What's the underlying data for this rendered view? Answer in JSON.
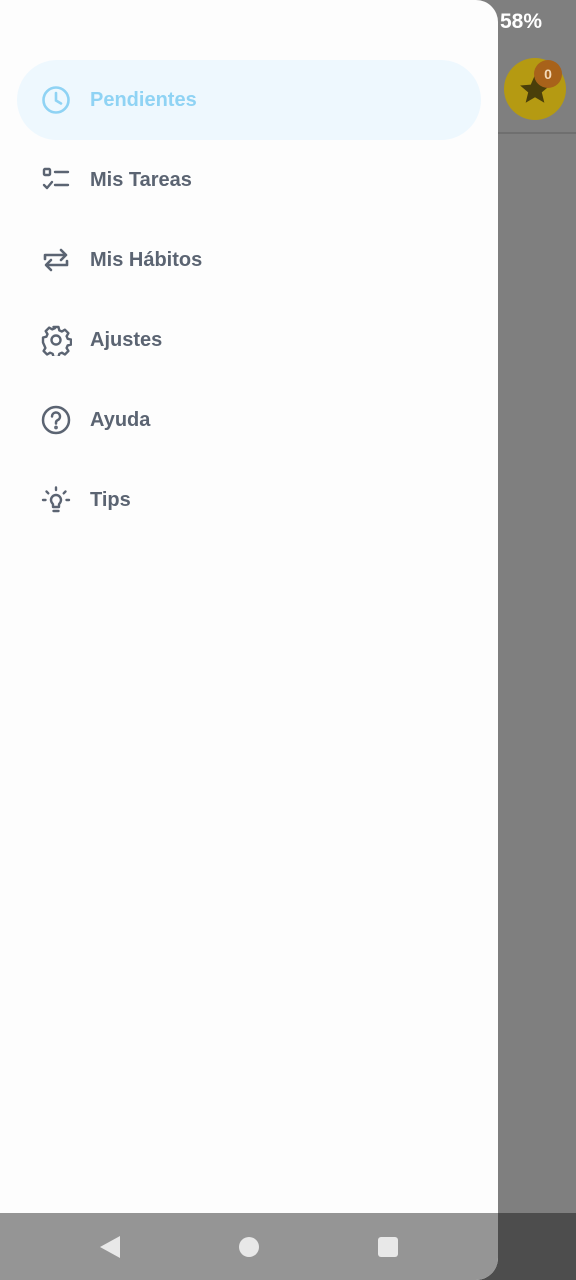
{
  "status_bar": {
    "battery": "58%"
  },
  "app_bar": {
    "points_badge": "0"
  },
  "drawer": {
    "items": [
      {
        "label": "Pendientes",
        "icon": "clock-icon",
        "active": true
      },
      {
        "label": "Mis Tareas",
        "icon": "checklist-icon",
        "active": false
      },
      {
        "label": "Mis Hábitos",
        "icon": "repeat-icon",
        "active": false
      },
      {
        "label": "Ajustes",
        "icon": "gear-icon",
        "active": false
      },
      {
        "label": "Ayuda",
        "icon": "help-icon",
        "active": false
      },
      {
        "label": "Tips",
        "icon": "lightbulb-icon",
        "active": false
      }
    ]
  },
  "colors": {
    "active_text": "#8fd3f4",
    "active_bg": "#eef8fe",
    "item_text": "#5b6472",
    "star_badge": "#b59a12"
  }
}
